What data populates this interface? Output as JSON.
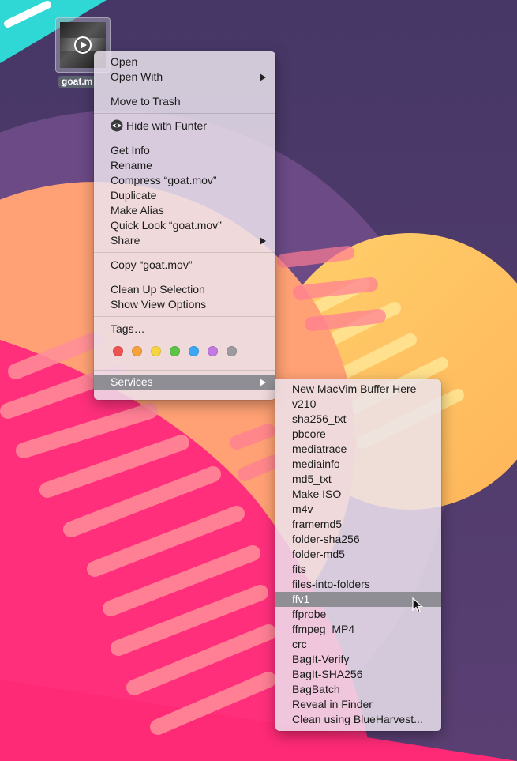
{
  "file": {
    "name": "goat.mov",
    "label": "goat.m"
  },
  "context_menu": {
    "groups": [
      [
        {
          "label": "Open"
        },
        {
          "label": "Open With",
          "submenu": true
        }
      ],
      [
        {
          "label": "Move to Trash"
        }
      ],
      [
        {
          "label": "Hide with Funter",
          "icon": "eye-icon"
        }
      ],
      [
        {
          "label": "Get Info"
        },
        {
          "label": "Rename"
        },
        {
          "label": "Compress “goat.mov”"
        },
        {
          "label": "Duplicate"
        },
        {
          "label": "Make Alias"
        },
        {
          "label": "Quick Look “goat.mov”"
        },
        {
          "label": "Share",
          "submenu": true
        }
      ],
      [
        {
          "label": "Copy “goat.mov”"
        }
      ],
      [
        {
          "label": "Clean Up Selection"
        },
        {
          "label": "Show View Options"
        }
      ],
      [
        {
          "label": "Tags…"
        }
      ]
    ],
    "tag_colors": [
      {
        "name": "red",
        "color": "#f0524f"
      },
      {
        "name": "orange",
        "color": "#f5a23b"
      },
      {
        "name": "yellow",
        "color": "#f6d53f"
      },
      {
        "name": "green",
        "color": "#5cc447"
      },
      {
        "name": "blue",
        "color": "#3da7f3"
      },
      {
        "name": "purple",
        "color": "#c17ae0"
      },
      {
        "name": "gray",
        "color": "#9c9ca0"
      }
    ],
    "services": {
      "label": "Services",
      "submenu": true,
      "highlighted": true
    }
  },
  "services_menu": {
    "items": [
      {
        "label": "New MacVim Buffer Here"
      },
      {
        "label": "v210"
      },
      {
        "label": "sha256_txt"
      },
      {
        "label": "pbcore"
      },
      {
        "label": "mediatrace"
      },
      {
        "label": "mediainfo"
      },
      {
        "label": "md5_txt"
      },
      {
        "label": "Make ISO"
      },
      {
        "label": "m4v"
      },
      {
        "label": "framemd5"
      },
      {
        "label": "folder-sha256"
      },
      {
        "label": "folder-md5"
      },
      {
        "label": "fits"
      },
      {
        "label": "files-into-folders"
      },
      {
        "label": "ffv1",
        "highlighted": true
      },
      {
        "label": "ffprobe"
      },
      {
        "label": "ffmpeg_MP4"
      },
      {
        "label": "crc"
      },
      {
        "label": "BagIt-Verify"
      },
      {
        "label": "BagIt-SHA256"
      },
      {
        "label": "BagBatch"
      },
      {
        "label": "Reveal in Finder"
      },
      {
        "label": "Clean using BlueHarvest..."
      }
    ]
  },
  "colors": {
    "menu_highlight": "#8e8e94",
    "wallpaper_pink": "#ff2f7c",
    "wallpaper_purple": "#4b3a6b",
    "wallpaper_peach": "#ffa070",
    "wallpaper_yellow": "#ffce6a",
    "wallpaper_cyan": "#22d6d6"
  }
}
